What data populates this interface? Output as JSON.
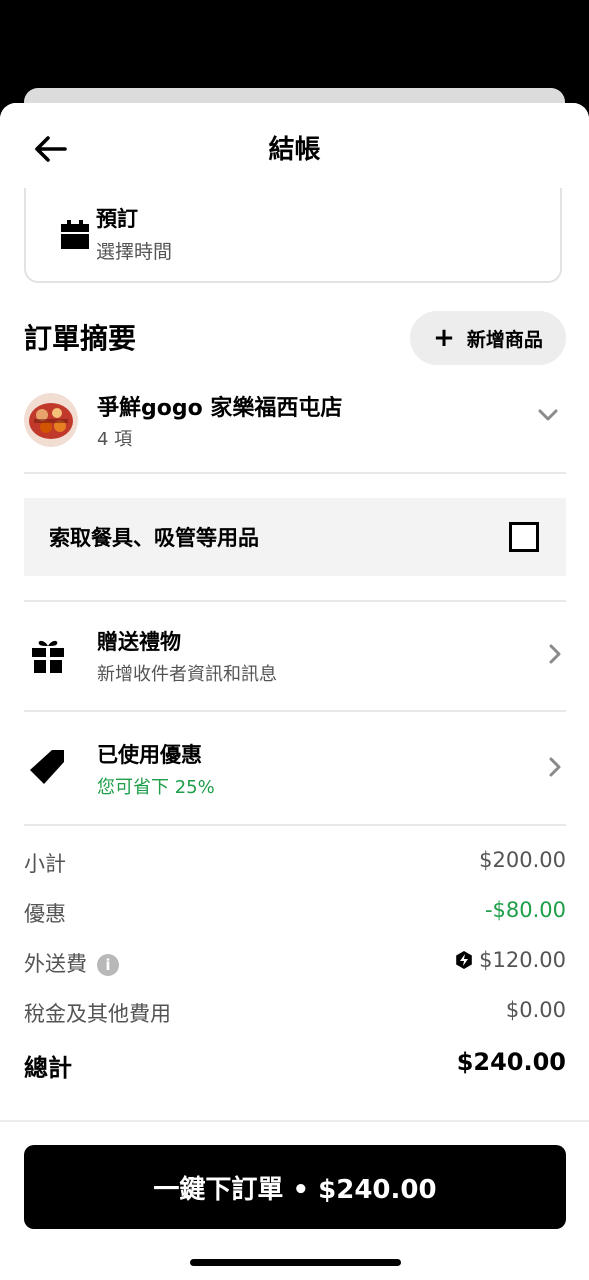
{
  "header": {
    "title": "結帳"
  },
  "schedule": {
    "title": "預訂",
    "subtitle": "選擇時間"
  },
  "order_summary": {
    "title": "訂單摘要",
    "add_item_label": "新增商品",
    "store": {
      "name": "爭鮮gogo 家樂福西屯店",
      "item_count": "4 項"
    }
  },
  "utensils": {
    "label": "索取餐具、吸管等用品",
    "checked": false
  },
  "gift": {
    "title": "贈送禮物",
    "subtitle": "新增收件者資訊和訊息"
  },
  "promotion": {
    "title": "已使用優惠",
    "subtitle": "您可省下 25%"
  },
  "costs": {
    "subtotal": {
      "label": "小計",
      "value": "$200.00"
    },
    "discount": {
      "label": "優惠",
      "value": "-$80.00"
    },
    "delivery": {
      "label": "外送費",
      "value": "$120.00"
    },
    "tax": {
      "label": "稅金及其他費用",
      "value": "$0.00"
    },
    "total": {
      "label": "總計",
      "value": "$240.00"
    }
  },
  "place_order": {
    "label": "一鍵下訂單 • $240.00"
  },
  "colors": {
    "accent_green": "#1e9e48",
    "button_black": "#000000",
    "chip_gray": "#ededed"
  },
  "icons": [
    "back-arrow-icon",
    "calendar-icon",
    "plus-icon",
    "chevron-down-icon",
    "gift-icon",
    "chevron-right-icon",
    "tag-icon",
    "info-icon",
    "lightning-bolt-icon"
  ]
}
